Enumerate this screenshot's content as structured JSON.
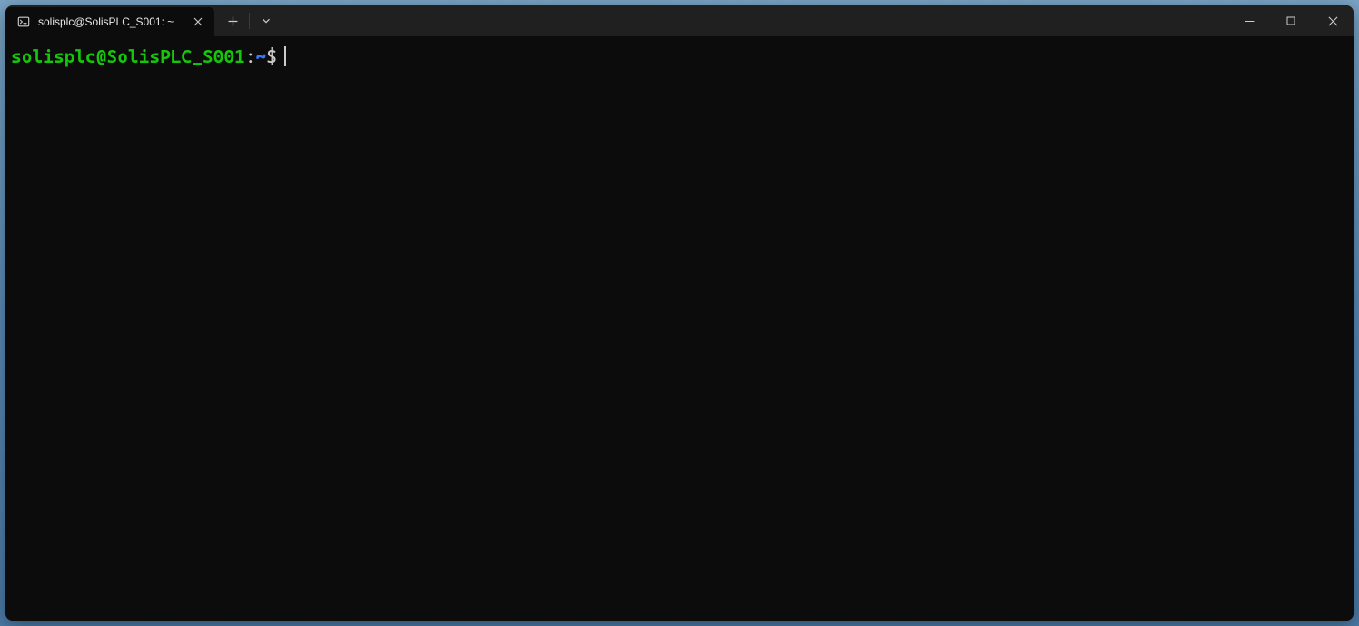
{
  "window": {
    "tab_title": "solisplc@SolisPLC_S001: ~"
  },
  "prompt": {
    "userhost": "solisplc@SolisPLC_S001",
    "separator": ":",
    "path": "~",
    "symbol": "$",
    "input": ""
  },
  "colors": {
    "bg": "#0c0c0c",
    "titlebar": "#202020",
    "green": "#16c60c",
    "blue": "#3b78ff",
    "fg": "#cccccc"
  }
}
